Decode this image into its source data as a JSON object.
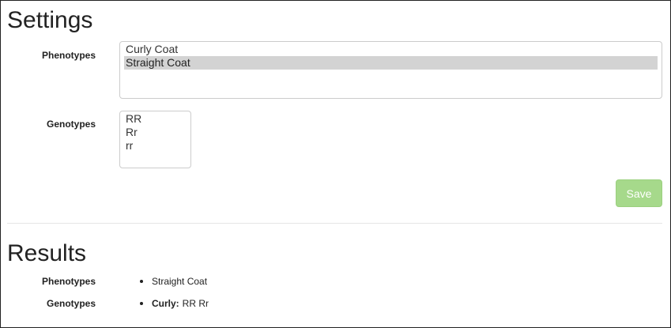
{
  "settings": {
    "title": "Settings",
    "phenotypes_label": "Phenotypes",
    "phenotypes_options": [
      {
        "label": "Curly Coat",
        "selected": false
      },
      {
        "label": "Straight Coat",
        "selected": true
      }
    ],
    "genotypes_label": "Genotypes",
    "genotypes_options": [
      {
        "label": "RR",
        "selected": false
      },
      {
        "label": "Rr",
        "selected": false
      },
      {
        "label": "rr",
        "selected": false
      }
    ],
    "save_label": "Save"
  },
  "results": {
    "title": "Results",
    "phenotypes_label": "Phenotypes",
    "phenotypes_value": "Straight Coat",
    "genotypes_label": "Genotypes",
    "genotypes_key": "Curly:",
    "genotypes_value": "RR Rr"
  },
  "colors": {
    "save_button_bg": "#a6d98b",
    "selected_option_bg": "#d3d3d3"
  }
}
